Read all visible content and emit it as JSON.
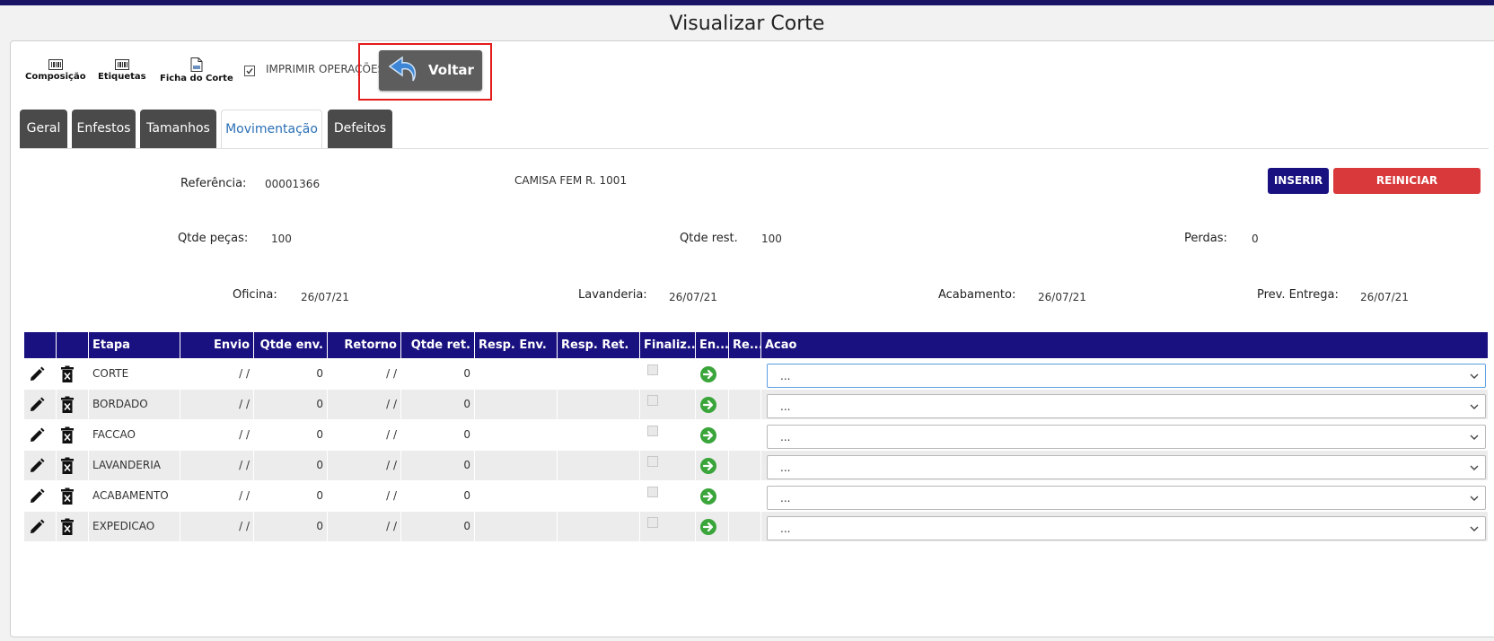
{
  "page": {
    "title": "Visualizar Corte"
  },
  "toolbar": {
    "composicao": "Composição",
    "etiquetas": "Etiquetas",
    "ficha": "Ficha do Corte",
    "imprimir": "IMPRIMIR OPERAÇÕES",
    "imprimir_checked": true,
    "voltar": "Voltar"
  },
  "tabs": [
    "Geral",
    "Enfestos",
    "Tamanhos",
    "Movimentação",
    "Defeitos"
  ],
  "active_tab": "Movimentação",
  "info": {
    "referencia_label": "Referência:",
    "referencia_value": "00001366",
    "descricao": "CAMISA FEM R. 1001",
    "qtde_pecas_label": "Qtde peças:",
    "qtde_pecas_value": "100",
    "qtde_rest_label": "Qtde rest.",
    "qtde_rest_value": "100",
    "perdas_label": "Perdas:",
    "perdas_value": "0",
    "oficina_label": "Oficina:",
    "oficina_value": "26/07/21",
    "lavanderia_label": "Lavanderia:",
    "lavanderia_value": "26/07/21",
    "acabamento_label": "Acabamento:",
    "acabamento_value": "26/07/21",
    "prev_entrega_label": "Prev. Entrega:",
    "prev_entrega_value": "26/07/21"
  },
  "actions": {
    "inserir": "INSERIR",
    "reiniciar": "REINICIAR CONFERÊNCIA"
  },
  "grid": {
    "headers": [
      "",
      "",
      "Etapa",
      "Envio",
      "Qtde env.",
      "Retorno",
      "Qtde ret.",
      "Resp. Env.",
      "Resp. Ret.",
      "Finaliz...",
      "En...",
      "Re...",
      "Acao"
    ],
    "rows": [
      {
        "etapa": "CORTE",
        "envio": "/ /",
        "qtde_env": "0",
        "retorno": "/ /",
        "qtde_ret": "0",
        "acao": "..."
      },
      {
        "etapa": "BORDADO",
        "envio": "/ /",
        "qtde_env": "0",
        "retorno": "/ /",
        "qtde_ret": "0",
        "acao": "..."
      },
      {
        "etapa": "FACCAO",
        "envio": "/ /",
        "qtde_env": "0",
        "retorno": "/ /",
        "qtde_ret": "0",
        "acao": "..."
      },
      {
        "etapa": "LAVANDERIA",
        "envio": "/ /",
        "qtde_env": "0",
        "retorno": "/ /",
        "qtde_ret": "0",
        "acao": "..."
      },
      {
        "etapa": "ACABAMENTO",
        "envio": "/ /",
        "qtde_env": "0",
        "retorno": "/ /",
        "qtde_ret": "0",
        "acao": "..."
      },
      {
        "etapa": "EXPEDICAO",
        "envio": "/ /",
        "qtde_env": "0",
        "retorno": "/ /",
        "qtde_ret": "0",
        "acao": "..."
      }
    ]
  },
  "colors": {
    "brand": "#1a1180",
    "danger": "#d9393b",
    "tab_dark": "#4a4a4a",
    "highlight": "#e31b1b",
    "go_green": "#3aa53a"
  }
}
